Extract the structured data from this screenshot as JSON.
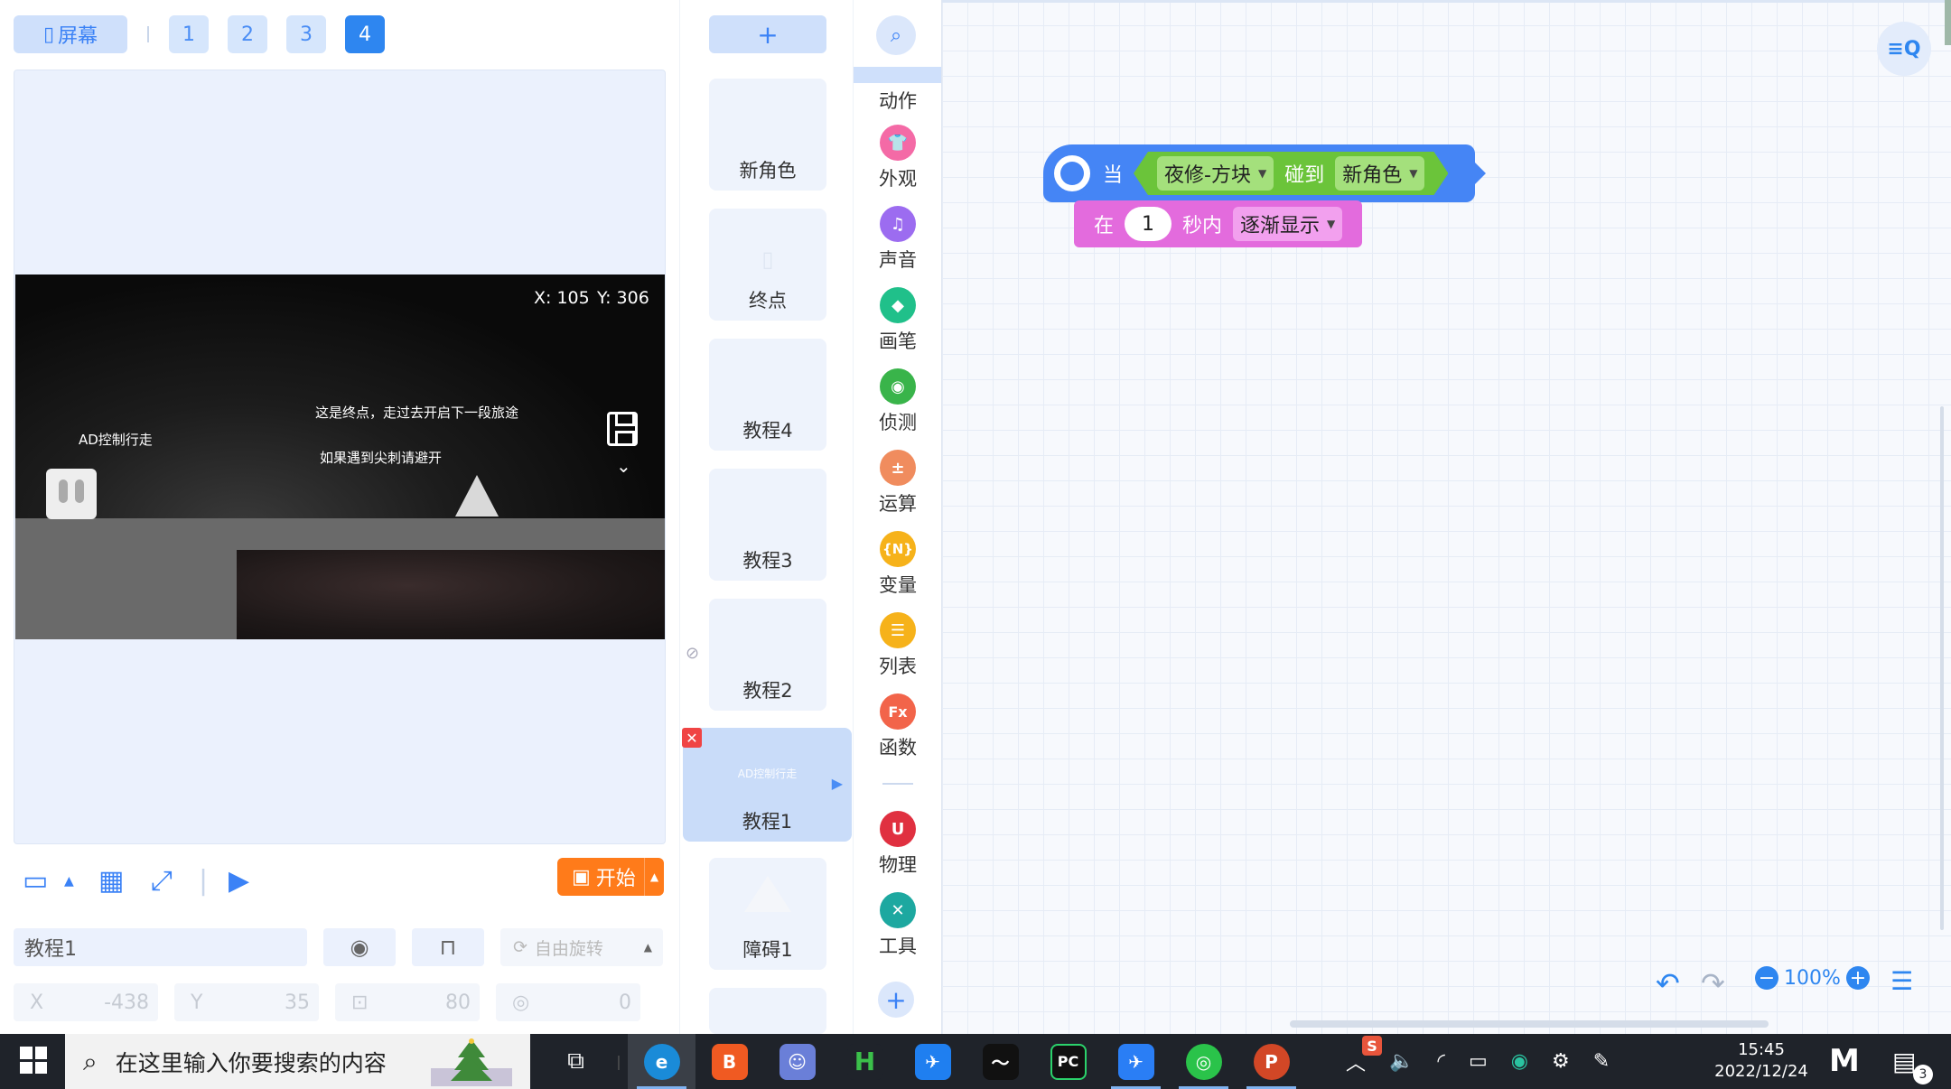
{
  "screen_bar": {
    "screen_label": "屏幕",
    "pages": [
      "1",
      "2",
      "3",
      "4"
    ],
    "active_page": "4"
  },
  "stage": {
    "coord_x": "X: 105",
    "coord_y": "Y: 306",
    "text_end": "这是终点，走过去开启下一段旅途",
    "text_spike": "如果遇到尖刺请避开",
    "text_ad": "AD控制行走"
  },
  "toolbar": {
    "start_label": "开始"
  },
  "sprite_props": {
    "name": "教程1",
    "rotation_label": "自由旋转",
    "x_label": "X",
    "x_value": "-438",
    "y_label": "Y",
    "y_value": "35",
    "size_value": "80",
    "direction_value": "0"
  },
  "sprites": {
    "add_label": "+",
    "items": [
      {
        "name": "新角色"
      },
      {
        "name": "终点"
      },
      {
        "name": "教程4"
      },
      {
        "name": "教程3"
      },
      {
        "name": "教程2"
      },
      {
        "name": "教程1",
        "thumb": "AD控制行走"
      },
      {
        "name": "障碍1"
      }
    ]
  },
  "categories": [
    {
      "label": "动作",
      "color": "#4585f5"
    },
    {
      "label": "外观",
      "color": "#f46aa6"
    },
    {
      "label": "声音",
      "color": "#9c6cf0"
    },
    {
      "label": "画笔",
      "color": "#20c08a"
    },
    {
      "label": "侦测",
      "color": "#39b44a"
    },
    {
      "label": "运算",
      "color": "#f08c5e"
    },
    {
      "label": "变量",
      "color": "#f6b21a",
      "glyph": "{N}"
    },
    {
      "label": "列表",
      "color": "#f6b21a"
    },
    {
      "label": "函数",
      "color": "#f2644a",
      "glyph": "Fx"
    },
    {
      "label": "物理",
      "color": "#e03040"
    },
    {
      "label": "工具",
      "color": "#1da8a0"
    }
  ],
  "blocks": {
    "hat_when": "当",
    "sprite_dropdown": "夜修-方块",
    "touching": "碰到",
    "target_dropdown": "新角色",
    "in_label": "在",
    "seconds_value": "1",
    "seconds_label": "秒内",
    "effect_dropdown": "逐渐显示"
  },
  "workspace": {
    "zoom": "100%"
  },
  "taskbar": {
    "search_placeholder": "在这里输入你要搜索的内容",
    "time": "15:45",
    "date": "2022/12/24",
    "notif_count": "3"
  }
}
